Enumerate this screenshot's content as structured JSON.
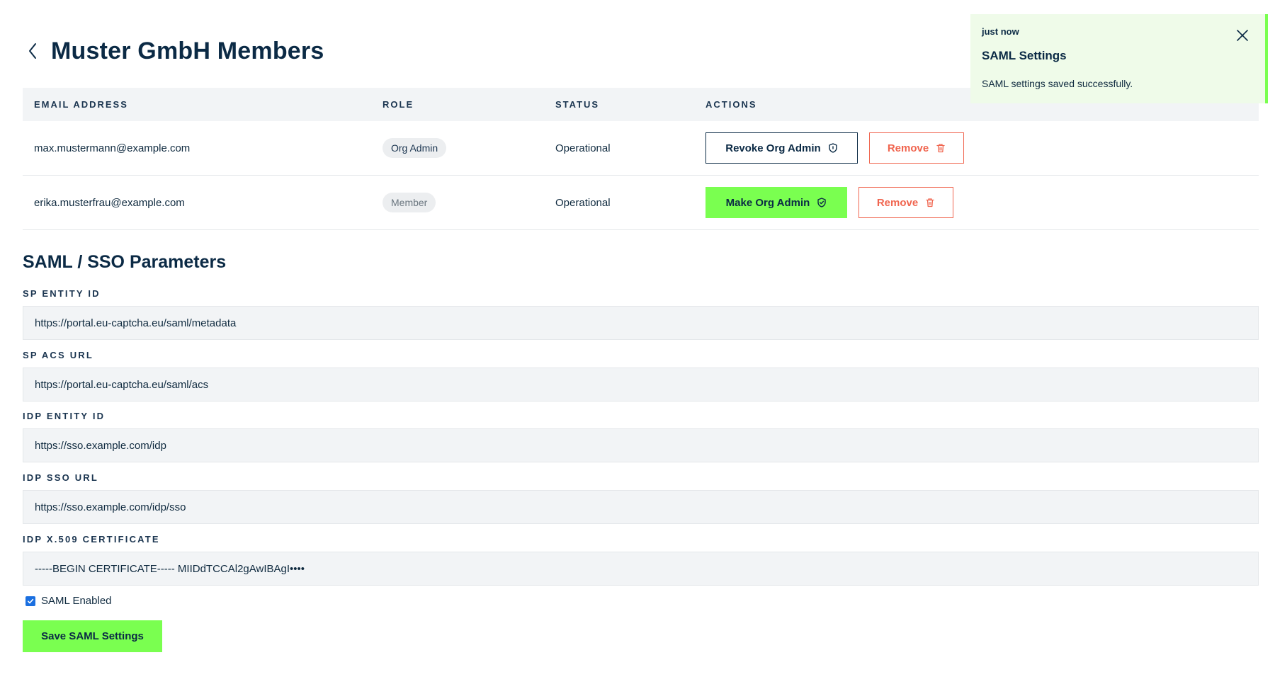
{
  "header": {
    "back_icon": "chevron-left-icon",
    "title": "Muster GmbH Members"
  },
  "table": {
    "columns": [
      "EMAIL ADDRESS",
      "ROLE",
      "STATUS",
      "ACTIONS"
    ],
    "rows": [
      {
        "email": "max.mustermann@example.com",
        "role": "Org Admin",
        "status": "Operational",
        "primary_action": "Revoke Org Admin",
        "primary_icon": "shield-icon",
        "remove_label": "Remove",
        "remove_icon": "trash-icon"
      },
      {
        "email": "erika.musterfrau@example.com",
        "role": "Member",
        "status": "Operational",
        "primary_action": "Make Org Admin",
        "primary_icon": "shield-check-icon",
        "remove_label": "Remove",
        "remove_icon": "trash-icon"
      }
    ]
  },
  "saml": {
    "title": "SAML / SSO Parameters",
    "fields": [
      {
        "label": "SP ENTITY ID",
        "value": "https://portal.eu-captcha.eu/saml/metadata"
      },
      {
        "label": "SP ACS URL",
        "value": "https://portal.eu-captcha.eu/saml/acs"
      },
      {
        "label": "IDP ENTITY ID",
        "value": "https://sso.example.com/idp"
      },
      {
        "label": "IDP SSO URL",
        "value": "https://sso.example.com/idp/sso"
      },
      {
        "label": "IDP X.509 CERTIFICATE",
        "value": "-----BEGIN CERTIFICATE----- MIIDdTCCAl2gAwIBAgI••••"
      }
    ],
    "enabled_label": "SAML Enabled",
    "enabled": true,
    "save_label": "Save SAML Settings"
  },
  "toast": {
    "time": "just now",
    "title": "SAML Settings",
    "message": "SAML settings saved successfully.",
    "close_icon": "close-icon"
  },
  "colors": {
    "brand_dark": "#0b2a45",
    "accent_green": "#7aff50",
    "danger": "#f0654f",
    "toast_bg": "#effbe9"
  }
}
